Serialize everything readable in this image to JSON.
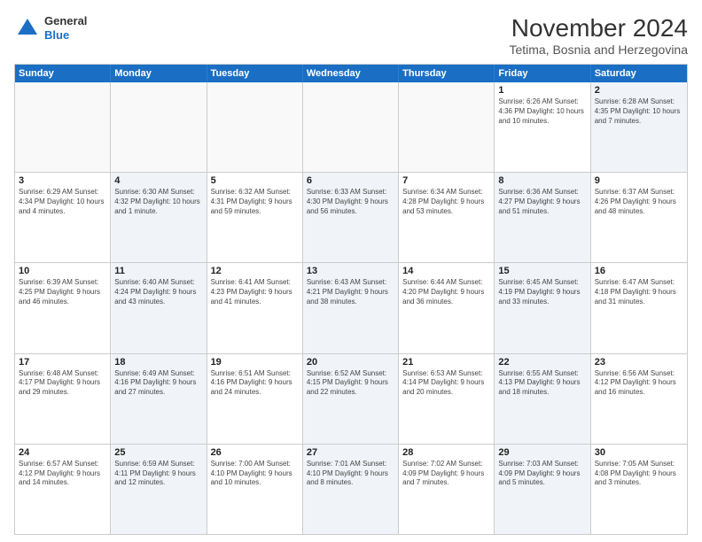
{
  "logo": {
    "general": "General",
    "blue": "Blue"
  },
  "header": {
    "month": "November 2024",
    "location": "Tetima, Bosnia and Herzegovina"
  },
  "weekdays": [
    "Sunday",
    "Monday",
    "Tuesday",
    "Wednesday",
    "Thursday",
    "Friday",
    "Saturday"
  ],
  "rows": [
    [
      {
        "day": "",
        "info": "",
        "empty": true
      },
      {
        "day": "",
        "info": "",
        "empty": true
      },
      {
        "day": "",
        "info": "",
        "empty": true
      },
      {
        "day": "",
        "info": "",
        "empty": true
      },
      {
        "day": "",
        "info": "",
        "empty": true
      },
      {
        "day": "1",
        "info": "Sunrise: 6:26 AM\nSunset: 4:36 PM\nDaylight: 10 hours and 10 minutes.",
        "empty": false,
        "alt": false
      },
      {
        "day": "2",
        "info": "Sunrise: 6:28 AM\nSunset: 4:35 PM\nDaylight: 10 hours and 7 minutes.",
        "empty": false,
        "alt": true
      }
    ],
    [
      {
        "day": "3",
        "info": "Sunrise: 6:29 AM\nSunset: 4:34 PM\nDaylight: 10 hours and 4 minutes.",
        "empty": false,
        "alt": false
      },
      {
        "day": "4",
        "info": "Sunrise: 6:30 AM\nSunset: 4:32 PM\nDaylight: 10 hours and 1 minute.",
        "empty": false,
        "alt": true
      },
      {
        "day": "5",
        "info": "Sunrise: 6:32 AM\nSunset: 4:31 PM\nDaylight: 9 hours and 59 minutes.",
        "empty": false,
        "alt": false
      },
      {
        "day": "6",
        "info": "Sunrise: 6:33 AM\nSunset: 4:30 PM\nDaylight: 9 hours and 56 minutes.",
        "empty": false,
        "alt": true
      },
      {
        "day": "7",
        "info": "Sunrise: 6:34 AM\nSunset: 4:28 PM\nDaylight: 9 hours and 53 minutes.",
        "empty": false,
        "alt": false
      },
      {
        "day": "8",
        "info": "Sunrise: 6:36 AM\nSunset: 4:27 PM\nDaylight: 9 hours and 51 minutes.",
        "empty": false,
        "alt": true
      },
      {
        "day": "9",
        "info": "Sunrise: 6:37 AM\nSunset: 4:26 PM\nDaylight: 9 hours and 48 minutes.",
        "empty": false,
        "alt": false
      }
    ],
    [
      {
        "day": "10",
        "info": "Sunrise: 6:39 AM\nSunset: 4:25 PM\nDaylight: 9 hours and 46 minutes.",
        "empty": false,
        "alt": false
      },
      {
        "day": "11",
        "info": "Sunrise: 6:40 AM\nSunset: 4:24 PM\nDaylight: 9 hours and 43 minutes.",
        "empty": false,
        "alt": true
      },
      {
        "day": "12",
        "info": "Sunrise: 6:41 AM\nSunset: 4:23 PM\nDaylight: 9 hours and 41 minutes.",
        "empty": false,
        "alt": false
      },
      {
        "day": "13",
        "info": "Sunrise: 6:43 AM\nSunset: 4:21 PM\nDaylight: 9 hours and 38 minutes.",
        "empty": false,
        "alt": true
      },
      {
        "day": "14",
        "info": "Sunrise: 6:44 AM\nSunset: 4:20 PM\nDaylight: 9 hours and 36 minutes.",
        "empty": false,
        "alt": false
      },
      {
        "day": "15",
        "info": "Sunrise: 6:45 AM\nSunset: 4:19 PM\nDaylight: 9 hours and 33 minutes.",
        "empty": false,
        "alt": true
      },
      {
        "day": "16",
        "info": "Sunrise: 6:47 AM\nSunset: 4:18 PM\nDaylight: 9 hours and 31 minutes.",
        "empty": false,
        "alt": false
      }
    ],
    [
      {
        "day": "17",
        "info": "Sunrise: 6:48 AM\nSunset: 4:17 PM\nDaylight: 9 hours and 29 minutes.",
        "empty": false,
        "alt": false
      },
      {
        "day": "18",
        "info": "Sunrise: 6:49 AM\nSunset: 4:16 PM\nDaylight: 9 hours and 27 minutes.",
        "empty": false,
        "alt": true
      },
      {
        "day": "19",
        "info": "Sunrise: 6:51 AM\nSunset: 4:16 PM\nDaylight: 9 hours and 24 minutes.",
        "empty": false,
        "alt": false
      },
      {
        "day": "20",
        "info": "Sunrise: 6:52 AM\nSunset: 4:15 PM\nDaylight: 9 hours and 22 minutes.",
        "empty": false,
        "alt": true
      },
      {
        "day": "21",
        "info": "Sunrise: 6:53 AM\nSunset: 4:14 PM\nDaylight: 9 hours and 20 minutes.",
        "empty": false,
        "alt": false
      },
      {
        "day": "22",
        "info": "Sunrise: 6:55 AM\nSunset: 4:13 PM\nDaylight: 9 hours and 18 minutes.",
        "empty": false,
        "alt": true
      },
      {
        "day": "23",
        "info": "Sunrise: 6:56 AM\nSunset: 4:12 PM\nDaylight: 9 hours and 16 minutes.",
        "empty": false,
        "alt": false
      }
    ],
    [
      {
        "day": "24",
        "info": "Sunrise: 6:57 AM\nSunset: 4:12 PM\nDaylight: 9 hours and 14 minutes.",
        "empty": false,
        "alt": false
      },
      {
        "day": "25",
        "info": "Sunrise: 6:59 AM\nSunset: 4:11 PM\nDaylight: 9 hours and 12 minutes.",
        "empty": false,
        "alt": true
      },
      {
        "day": "26",
        "info": "Sunrise: 7:00 AM\nSunset: 4:10 PM\nDaylight: 9 hours and 10 minutes.",
        "empty": false,
        "alt": false
      },
      {
        "day": "27",
        "info": "Sunrise: 7:01 AM\nSunset: 4:10 PM\nDaylight: 9 hours and 8 minutes.",
        "empty": false,
        "alt": true
      },
      {
        "day": "28",
        "info": "Sunrise: 7:02 AM\nSunset: 4:09 PM\nDaylight: 9 hours and 7 minutes.",
        "empty": false,
        "alt": false
      },
      {
        "day": "29",
        "info": "Sunrise: 7:03 AM\nSunset: 4:09 PM\nDaylight: 9 hours and 5 minutes.",
        "empty": false,
        "alt": true
      },
      {
        "day": "30",
        "info": "Sunrise: 7:05 AM\nSunset: 4:08 PM\nDaylight: 9 hours and 3 minutes.",
        "empty": false,
        "alt": false
      }
    ]
  ]
}
